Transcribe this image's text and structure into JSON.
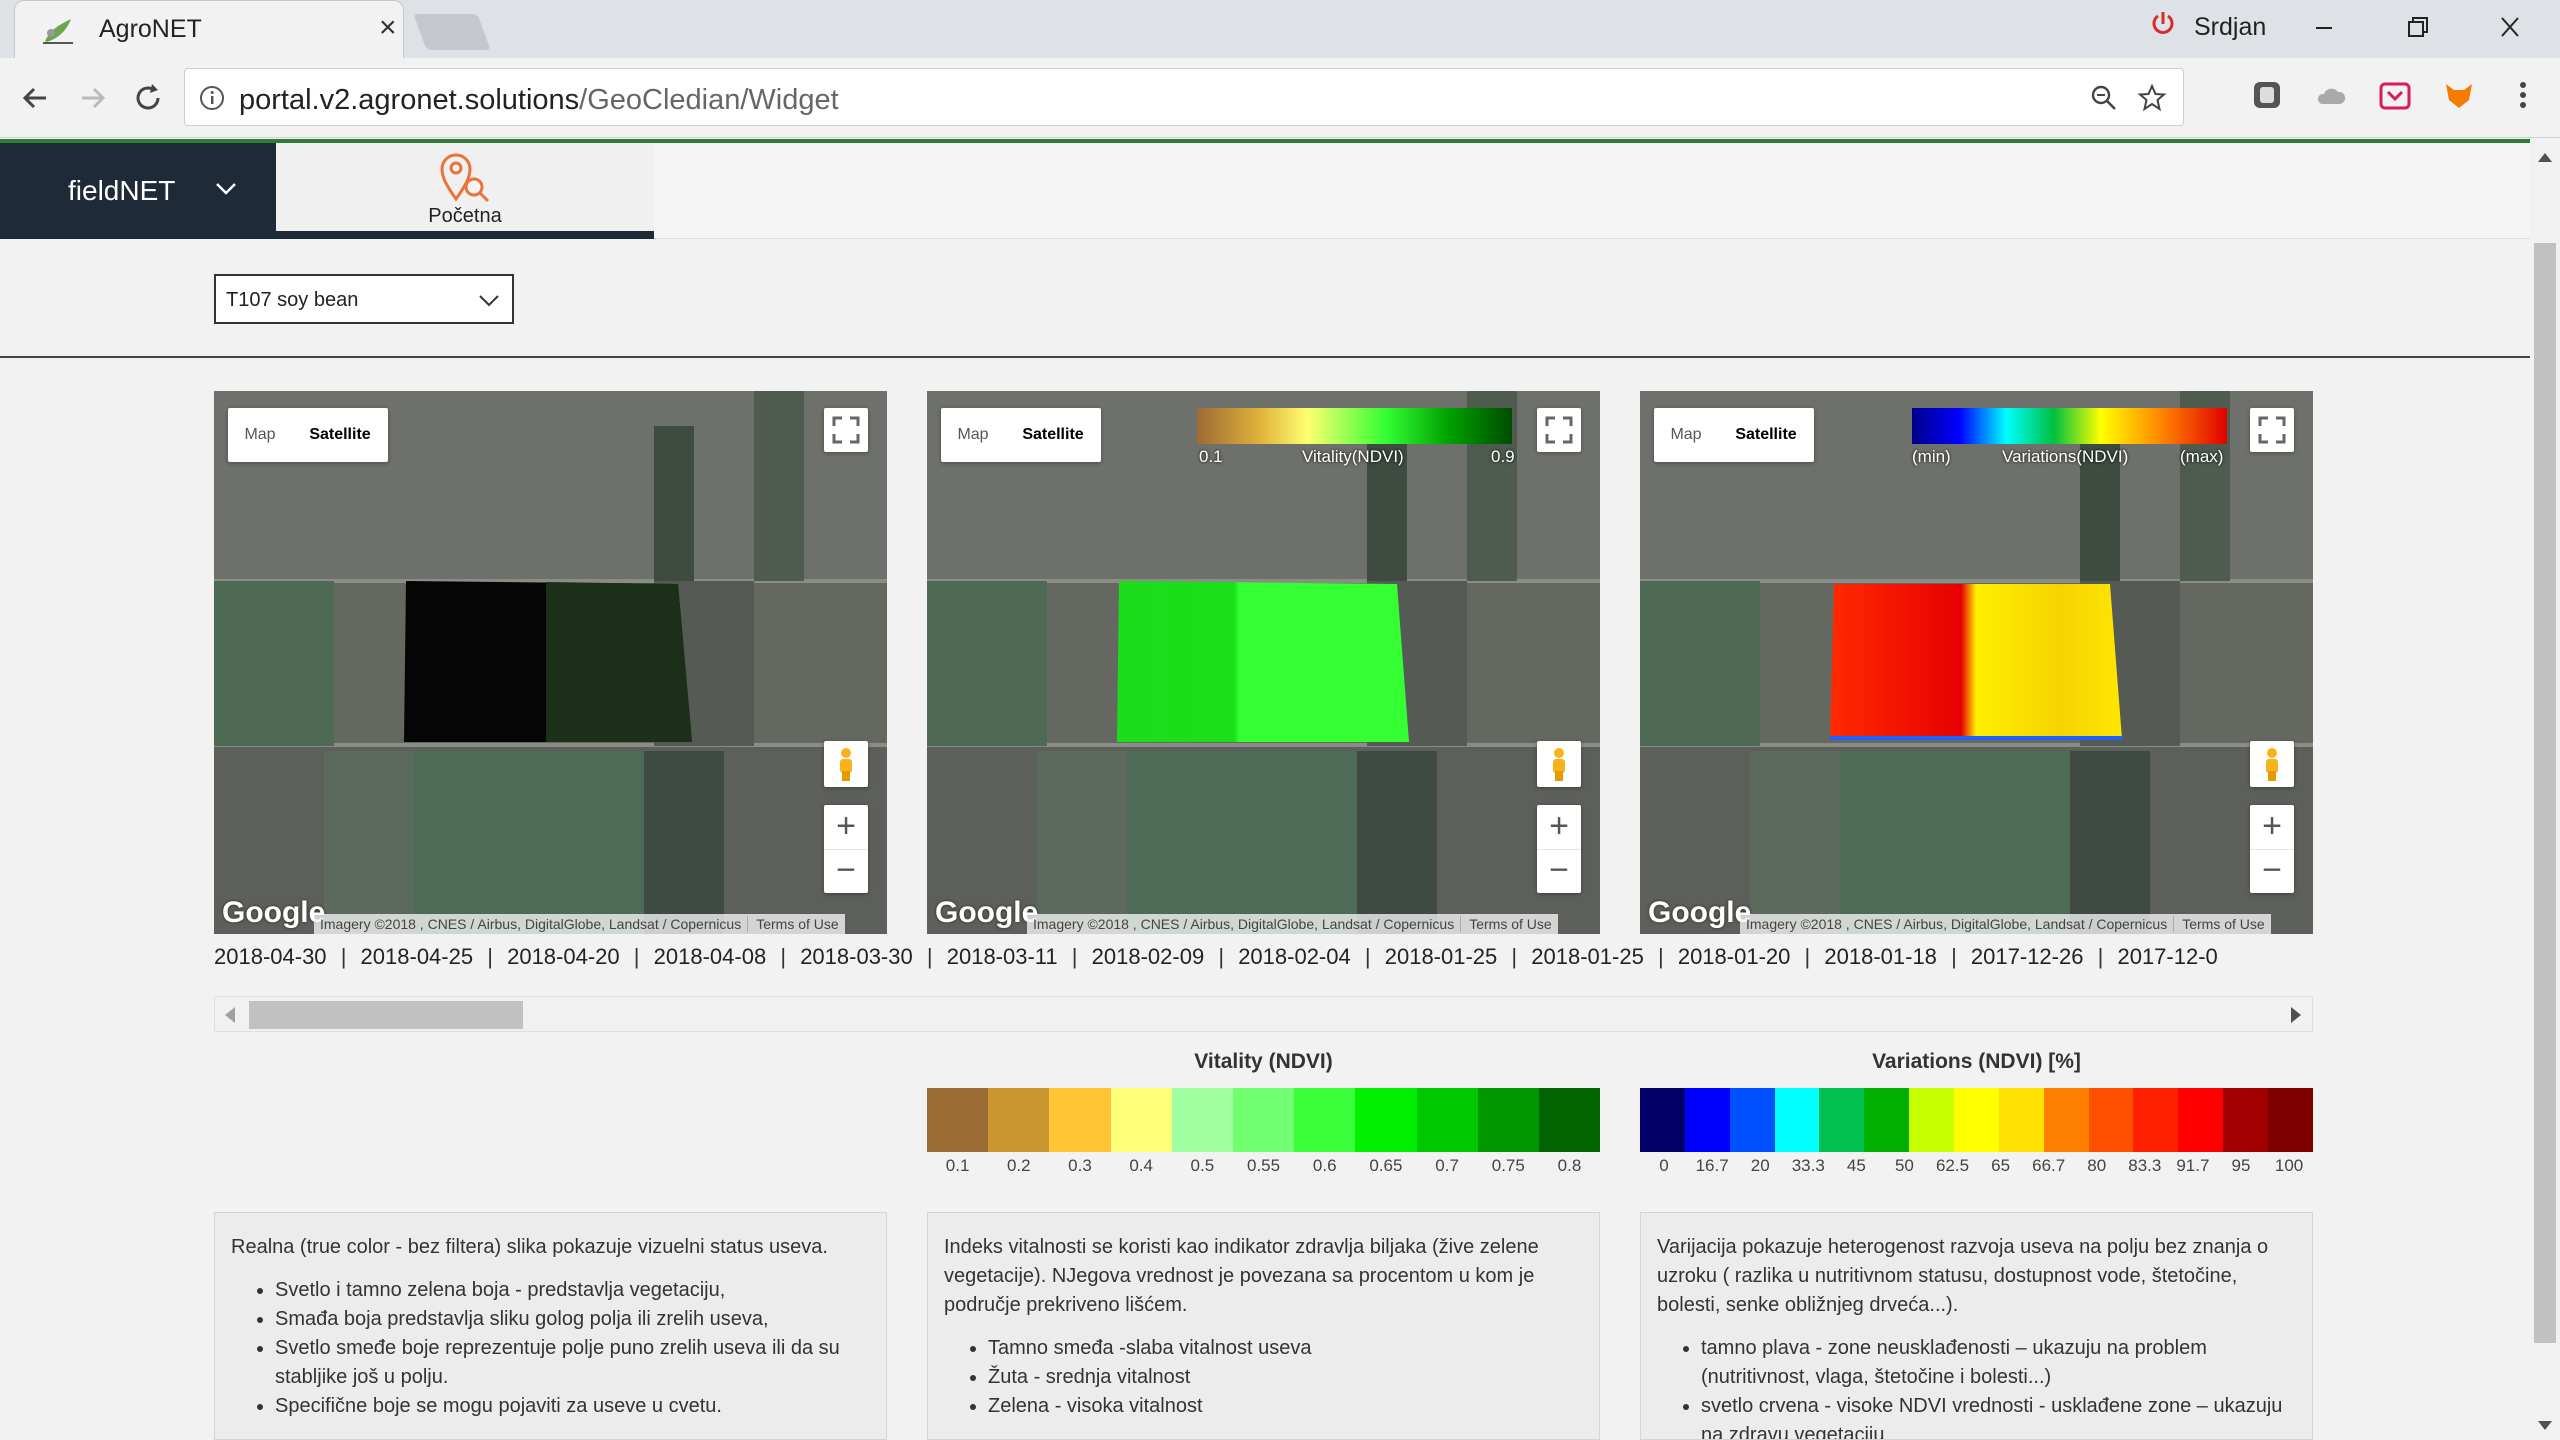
{
  "browser": {
    "tab_title": "AgroNET",
    "tab_close": "×",
    "profile_name": "Srdjan",
    "url_host": "portal.v2.agronet.solutions",
    "url_path": "/GeoCledian/Widget"
  },
  "app": {
    "brand": "fieldNET",
    "home_tab": "Početna",
    "field_select": "T107 soy bean"
  },
  "maps": [
    {
      "type_map": "Map",
      "type_satellite": "Satellite",
      "google": "Google",
      "attribution": "Imagery ©2018 , CNES / Airbus, DigitalGlobe, Landsat / Copernicus",
      "terms": "Terms of Use"
    },
    {
      "type_map": "Map",
      "type_satellite": "Satellite",
      "google": "Google",
      "attribution": "Imagery ©2018 , CNES / Airbus, DigitalGlobe, Landsat / Copernicus",
      "terms": "Terms of Use",
      "legend_min": "0.1",
      "legend_title": "Vitality(NDVI)",
      "legend_max": "0.9"
    },
    {
      "type_map": "Map",
      "type_satellite": "Satellite",
      "google": "Google",
      "attribution": "Imagery ©2018 , CNES / Airbus, DigitalGlobe, Landsat / Copernicus",
      "terms": "Terms of Use",
      "legend_min": "(min)",
      "legend_title": "Variations(NDVI)",
      "legend_max": "(max)"
    }
  ],
  "zoom": {
    "in": "+",
    "out": "−"
  },
  "dates": [
    "2018-04-30",
    "2018-04-25",
    "2018-04-20",
    "2018-04-08",
    "2018-03-30",
    "2018-03-11",
    "2018-02-09",
    "2018-02-04",
    "2018-01-25",
    "2018-01-25",
    "2018-01-20",
    "2018-01-18",
    "2017-12-26",
    "2017-12-0"
  ],
  "date_separator": "|",
  "scroll_position": 0.0,
  "vitality_scale": {
    "title": "Vitality (NDVI)",
    "colors": [
      "#9b6b35",
      "#c9962f",
      "#ffc534",
      "#ffff7a",
      "#a0ffa0",
      "#70ff70",
      "#3cff3c",
      "#00f000",
      "#00c800",
      "#009600",
      "#006400"
    ],
    "labels": [
      "0.1",
      "0.2",
      "0.3",
      "0.4",
      "0.5",
      "0.55",
      "0.6",
      "0.65",
      "0.7",
      "0.75",
      "0.8"
    ]
  },
  "variation_scale": {
    "title": "Variations (NDVI) [%]",
    "colors": [
      "#000066",
      "#0000ff",
      "#0050ff",
      "#00ffff",
      "#00c050",
      "#00b000",
      "#c8ff00",
      "#ffff00",
      "#ffe000",
      "#ff8000",
      "#ff5000",
      "#ff2000",
      "#ff0000",
      "#a00000",
      "#800000"
    ],
    "labels": [
      "0",
      "16.7",
      "20",
      "33.3",
      "45",
      "50",
      "62.5",
      "65",
      "66.7",
      "80",
      "83.3",
      "91.7",
      "95",
      "100"
    ]
  },
  "descriptions": [
    {
      "intro": "Realna (true color - bez filtera) slika pokazuje vizuelni status useva.",
      "items": [
        "Svetlo i tamno zelena boja - predstavlja vegetaciju,",
        "Smađa boja predstavlja sliku golog polja ili zrelih useva,",
        "Svetlo smeđe boje reprezentuje polje puno zrelih useva ili da su stabljike još u polju.",
        "Specifične boje se mogu pojaviti za useve u cvetu."
      ]
    },
    {
      "intro": "Indeks vitalnosti se koristi kao indikator zdravlja biljaka (žive zelene vegetacije). NJegova vrednost je povezana sa procentom u kom je područje prekriveno lišćem.",
      "items": [
        "Tamno smeđa -slaba vitalnost useva",
        "Žuta - srednja vitalnost",
        "Zelena - visoka vitalnost"
      ]
    },
    {
      "intro": "Varijacija pokazuje heterogenost razvoja useva na polju bez znanja o uzroku ( razlika u nutritivnom statusu, dostupnost vode, štetočine, bolesti, senke obližnjeg drveća...).",
      "items": [
        "tamno plava - zone neusklađenosti – ukazuju na problem (nutritivnost, vlaga, štetočine i bolesti...)",
        "svetlo crvena - visoke NDVI vrednosti - usklađene zone – ukazuju na zdravu vegetaciju"
      ]
    }
  ]
}
